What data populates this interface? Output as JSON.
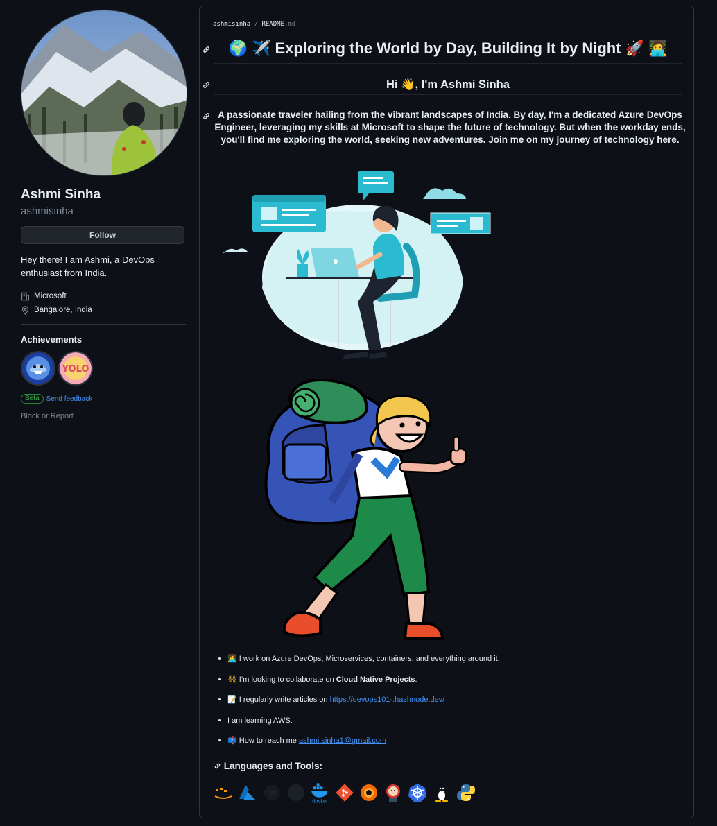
{
  "profile": {
    "name": "Ashmi Sinha",
    "username": "ashmisinha",
    "follow_label": "Follow",
    "bio": "Hey there! I am Ashmi, a DevOps enthusiast from India.",
    "company": "Microsoft",
    "location": "Bangalore, India",
    "achievements_title": "Achievements",
    "beta_label": "Beta",
    "feedback_label": "Send feedback",
    "block_label": "Block or Report"
  },
  "readme": {
    "breadcrumb_user": "ashmisinha",
    "breadcrumb_sep": "/",
    "breadcrumb_file": "README",
    "breadcrumb_ext": ".md",
    "heading1": "🌍 ✈️ Exploring the World by Day, Building It by Night 🚀 👩‍💻",
    "heading2": "Hi 👋, I'm Ashmi Sinha",
    "intro": "A passionate traveler hailing from the vibrant landscapes of India. By day, I'm a dedicated Azure DevOps Engineer, leveraging my skills at Microsoft to shape the future of technology. But when the workday ends, you'll find me exploring the world, seeking new adventures. Join me on my journey of technology here.",
    "bullets": {
      "b1_emoji": "👩‍💻",
      "b1_text": "I work on Azure DevOps, Microservices, containers, and everything around it.",
      "b2_emoji": "👯",
      "b2_text": "I’m looking to collaborate on ",
      "b2_bold": "Cloud Native Projects",
      "b2_end": ".",
      "b3_emoji": "📝",
      "b3_text": "I regularly write articles on ",
      "b3_link": "https://devops101-.hashnode.dev/",
      "b4_text": "I am learning AWS.",
      "b5_emoji": "📫",
      "b5_text": "How to reach me ",
      "b5_link": "ashmi.sinha1@gmail.com"
    },
    "tools_title": "Languages and Tools:",
    "tools": [
      "aws",
      "azure",
      "circleci",
      "circleci-dark",
      "docker",
      "git",
      "grafana",
      "jenkins",
      "kubernetes",
      "linux",
      "python"
    ],
    "docker_label": "docker"
  },
  "colors": {
    "background": "#0d1117",
    "border": "#30363d",
    "link": "#4493f8",
    "muted": "#7d8590"
  }
}
